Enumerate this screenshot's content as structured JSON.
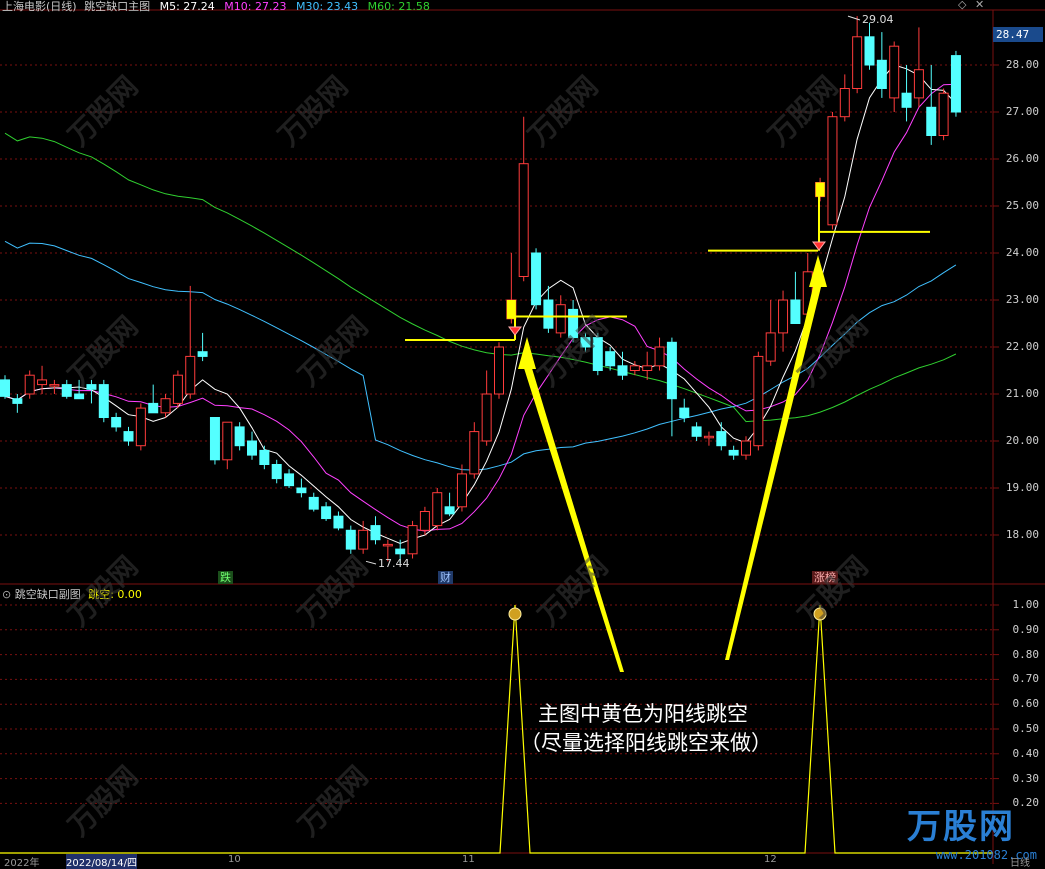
{
  "header": {
    "title": "上海电影(日线)",
    "indicator": "跳空缺口主图",
    "ma5": "M5: 27.24",
    "ma10": "M10: 27.23",
    "ma30": "M30: 23.43",
    "ma60": "M60: 21.58"
  },
  "sub_header": {
    "indicator": "跳空缺口副图",
    "value": "跳空: 0.00"
  },
  "current_price": "28.47",
  "price_axis": [
    "28.00",
    "27.00",
    "26.00",
    "25.00",
    "24.00",
    "23.00",
    "22.00",
    "21.00",
    "20.00",
    "19.00",
    "18.00"
  ],
  "sub_axis": [
    "1.00",
    "0.90",
    "0.80",
    "0.70",
    "0.60",
    "0.50",
    "0.40",
    "0.30",
    "0.20"
  ],
  "marks": {
    "high": "29.04",
    "low": "17.44"
  },
  "tags": {
    "fall": "跌",
    "fin": "财",
    "rise": "涨榜"
  },
  "annotation": {
    "line1": "主图中黄色为阳线跳空",
    "line2": "（尽量选择阳线跳空来做）"
  },
  "watermark": {
    "text": "万股网",
    "url": "www.201082.com"
  },
  "logo": {
    "text": "万股网",
    "url": "www.201082.com"
  },
  "bottom_bar": {
    "year": "2022年",
    "date": "2022/08/14/四",
    "m1": "10",
    "m2": "11",
    "m3": "12",
    "cycle": "日线"
  },
  "colors": {
    "up": "#ff3c3c",
    "down": "#54ffff",
    "ma5": "#ffffff",
    "ma10": "#ff40ff",
    "ma30": "#40c0ff",
    "ma60": "#30d030",
    "gap": "#ffff00",
    "grid": "#7a1010"
  },
  "chart_data": {
    "type": "candlestick",
    "ylim": [
      17.2,
      29.3
    ],
    "candles": [
      {
        "o": 21.3,
        "h": 21.4,
        "l": 20.9,
        "c": 20.95
      },
      {
        "o": 20.9,
        "h": 21.0,
        "l": 20.6,
        "c": 20.8
      },
      {
        "o": 21.0,
        "h": 21.5,
        "l": 20.9,
        "c": 21.4
      },
      {
        "o": 21.2,
        "h": 21.6,
        "l": 21.0,
        "c": 21.3
      },
      {
        "o": 21.2,
        "h": 21.3,
        "l": 21.0,
        "c": 21.2
      },
      {
        "o": 21.2,
        "h": 21.3,
        "l": 20.9,
        "c": 20.95
      },
      {
        "o": 21.0,
        "h": 21.3,
        "l": 20.9,
        "c": 20.9
      },
      {
        "o": 21.2,
        "h": 21.3,
        "l": 20.8,
        "c": 21.1
      },
      {
        "o": 21.2,
        "h": 21.3,
        "l": 20.4,
        "c": 20.5
      },
      {
        "o": 20.5,
        "h": 20.6,
        "l": 20.2,
        "c": 20.3
      },
      {
        "o": 20.2,
        "h": 20.3,
        "l": 19.9,
        "c": 20.0
      },
      {
        "o": 19.9,
        "h": 20.8,
        "l": 19.8,
        "c": 20.7
      },
      {
        "o": 20.8,
        "h": 21.2,
        "l": 20.6,
        "c": 20.6
      },
      {
        "o": 20.6,
        "h": 21.0,
        "l": 20.5,
        "c": 20.9
      },
      {
        "o": 20.8,
        "h": 21.5,
        "l": 20.7,
        "c": 21.4
      },
      {
        "o": 21.0,
        "h": 23.3,
        "l": 20.9,
        "c": 21.8
      },
      {
        "o": 21.9,
        "h": 22.3,
        "l": 21.7,
        "c": 21.8
      },
      {
        "o": 20.5,
        "h": 20.5,
        "l": 19.5,
        "c": 19.6
      },
      {
        "o": 19.6,
        "h": 20.2,
        "l": 19.4,
        "c": 20.4
      },
      {
        "o": 20.3,
        "h": 20.4,
        "l": 19.8,
        "c": 19.9
      },
      {
        "o": 20.0,
        "h": 20.2,
        "l": 19.6,
        "c": 19.7
      },
      {
        "o": 19.8,
        "h": 19.9,
        "l": 19.4,
        "c": 19.5
      },
      {
        "o": 19.5,
        "h": 19.6,
        "l": 19.1,
        "c": 19.2
      },
      {
        "o": 19.3,
        "h": 19.4,
        "l": 19.0,
        "c": 19.05
      },
      {
        "o": 19.0,
        "h": 19.2,
        "l": 18.8,
        "c": 18.9
      },
      {
        "o": 18.8,
        "h": 18.9,
        "l": 18.5,
        "c": 18.55
      },
      {
        "o": 18.6,
        "h": 18.7,
        "l": 18.3,
        "c": 18.35
      },
      {
        "o": 18.4,
        "h": 18.5,
        "l": 18.1,
        "c": 18.15
      },
      {
        "o": 18.1,
        "h": 18.2,
        "l": 17.6,
        "c": 17.7
      },
      {
        "o": 17.7,
        "h": 18.3,
        "l": 17.6,
        "c": 18.1
      },
      {
        "o": 18.2,
        "h": 18.4,
        "l": 17.8,
        "c": 17.9
      },
      {
        "o": 17.8,
        "h": 17.9,
        "l": 17.44,
        "c": 17.8
      },
      {
        "o": 17.7,
        "h": 17.9,
        "l": 17.4,
        "c": 17.6
      },
      {
        "o": 17.6,
        "h": 18.3,
        "l": 17.5,
        "c": 18.2
      },
      {
        "o": 18.1,
        "h": 18.6,
        "l": 18.0,
        "c": 18.5
      },
      {
        "o": 18.2,
        "h": 19.0,
        "l": 18.1,
        "c": 18.9
      },
      {
        "o": 18.6,
        "h": 18.9,
        "l": 18.4,
        "c": 18.45
      },
      {
        "o": 18.6,
        "h": 19.5,
        "l": 18.5,
        "c": 19.3
      },
      {
        "o": 19.3,
        "h": 20.4,
        "l": 19.2,
        "c": 20.2
      },
      {
        "o": 20.0,
        "h": 21.5,
        "l": 19.9,
        "c": 21.0
      },
      {
        "o": 21.0,
        "h": 22.1,
        "l": 20.9,
        "c": 22.0
      },
      {
        "o": 22.6,
        "h": 24.0,
        "l": 22.5,
        "c": 23.0
      },
      {
        "o": 23.5,
        "h": 26.9,
        "l": 23.4,
        "c": 25.9
      },
      {
        "o": 24.0,
        "h": 24.1,
        "l": 22.8,
        "c": 22.9
      },
      {
        "o": 23.0,
        "h": 23.3,
        "l": 22.3,
        "c": 22.4
      },
      {
        "o": 22.3,
        "h": 23.1,
        "l": 22.2,
        "c": 22.9
      },
      {
        "o": 22.8,
        "h": 23.0,
        "l": 22.1,
        "c": 22.2
      },
      {
        "o": 22.2,
        "h": 22.3,
        "l": 21.9,
        "c": 22.0
      },
      {
        "o": 22.2,
        "h": 22.3,
        "l": 21.4,
        "c": 21.5
      },
      {
        "o": 21.9,
        "h": 22.0,
        "l": 21.5,
        "c": 21.6
      },
      {
        "o": 21.6,
        "h": 21.9,
        "l": 21.3,
        "c": 21.4
      },
      {
        "o": 21.5,
        "h": 21.7,
        "l": 21.4,
        "c": 21.6
      },
      {
        "o": 21.5,
        "h": 21.9,
        "l": 21.3,
        "c": 21.6
      },
      {
        "o": 21.6,
        "h": 22.2,
        "l": 21.5,
        "c": 22.0
      },
      {
        "o": 22.1,
        "h": 22.2,
        "l": 20.1,
        "c": 20.9
      },
      {
        "o": 20.7,
        "h": 20.9,
        "l": 20.4,
        "c": 20.5
      },
      {
        "o": 20.3,
        "h": 20.4,
        "l": 20.0,
        "c": 20.1
      },
      {
        "o": 20.1,
        "h": 20.2,
        "l": 19.9,
        "c": 20.1
      },
      {
        "o": 20.2,
        "h": 20.4,
        "l": 19.8,
        "c": 19.9
      },
      {
        "o": 19.8,
        "h": 19.9,
        "l": 19.6,
        "c": 19.7
      },
      {
        "o": 19.7,
        "h": 20.1,
        "l": 19.6,
        "c": 20.0
      },
      {
        "o": 19.9,
        "h": 21.9,
        "l": 19.8,
        "c": 21.8
      },
      {
        "o": 21.7,
        "h": 23.0,
        "l": 21.6,
        "c": 22.3
      },
      {
        "o": 22.3,
        "h": 23.2,
        "l": 21.9,
        "c": 23.0
      },
      {
        "o": 23.0,
        "h": 23.6,
        "l": 22.5,
        "c": 22.5
      },
      {
        "o": 22.7,
        "h": 24.0,
        "l": 22.6,
        "c": 23.6
      },
      {
        "o": 25.2,
        "h": 25.6,
        "l": 25.1,
        "c": 25.5
      },
      {
        "o": 24.6,
        "h": 27.0,
        "l": 24.5,
        "c": 26.9
      },
      {
        "o": 26.9,
        "h": 27.8,
        "l": 26.8,
        "c": 27.5
      },
      {
        "o": 27.5,
        "h": 29.04,
        "l": 27.4,
        "c": 28.6
      },
      {
        "o": 28.6,
        "h": 28.9,
        "l": 27.9,
        "c": 28.0
      },
      {
        "o": 28.1,
        "h": 28.7,
        "l": 27.3,
        "c": 27.5
      },
      {
        "o": 27.3,
        "h": 28.5,
        "l": 27.0,
        "c": 28.4
      },
      {
        "o": 27.4,
        "h": 28.0,
        "l": 26.8,
        "c": 27.1
      },
      {
        "o": 27.3,
        "h": 28.8,
        "l": 27.1,
        "c": 27.9
      },
      {
        "o": 27.1,
        "h": 28.0,
        "l": 26.3,
        "c": 26.5
      },
      {
        "o": 26.5,
        "h": 27.5,
        "l": 26.4,
        "c": 27.4
      },
      {
        "o": 28.2,
        "h": 28.3,
        "l": 26.9,
        "c": 27.0
      }
    ],
    "gap_lines": [
      {
        "y": 22.15,
        "x1": 405,
        "x2": 515
      },
      {
        "y": 22.65,
        "x1": 515,
        "x2": 627
      },
      {
        "y": 24.05,
        "x1": 708,
        "x2": 818
      },
      {
        "y": 24.45,
        "x1": 820,
        "x2": 930
      }
    ],
    "sub_series": {
      "peaks_at_index": [
        41,
        65
      ],
      "value": 1.0
    }
  }
}
